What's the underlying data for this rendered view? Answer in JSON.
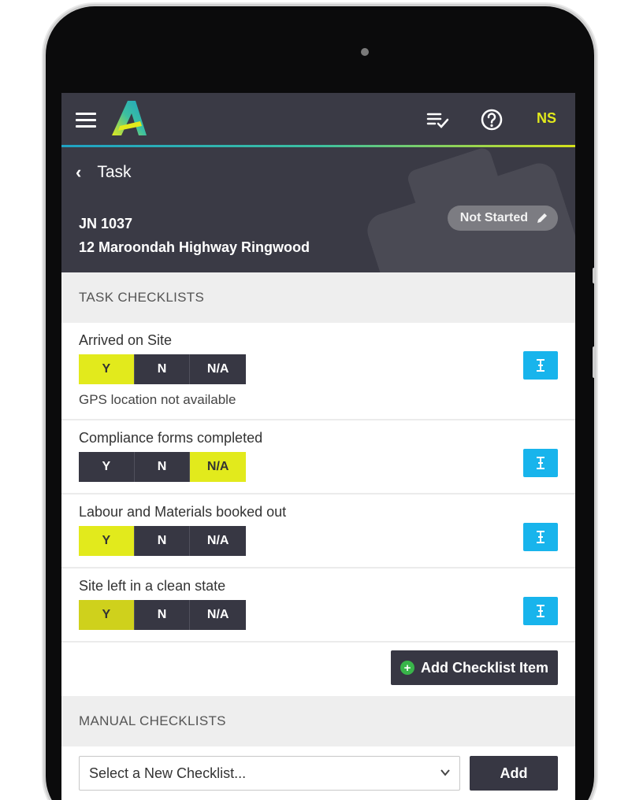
{
  "header": {
    "initials": "NS",
    "back_label": "Task",
    "job_number": "JN 1037",
    "job_address": "12 Maroondah Highway Ringwood",
    "status": "Not Started"
  },
  "task_checklists": {
    "heading": "TASK CHECKLISTS",
    "options": [
      "Y",
      "N",
      "N/A"
    ],
    "items": [
      {
        "label": "Arrived on Site",
        "selected": "Y",
        "note": "GPS location not available"
      },
      {
        "label": "Compliance forms completed",
        "selected": "N/A",
        "note": ""
      },
      {
        "label": "Labour and Materials booked out",
        "selected": "Y",
        "note": ""
      },
      {
        "label": "Site left in a clean state",
        "selected": "Y",
        "note": ""
      }
    ],
    "add_item_label": "Add Checklist Item"
  },
  "manual_checklists": {
    "heading": "MANUAL CHECKLISTS",
    "select_value": "Select a New Checklist...",
    "add_label": "Add"
  },
  "colors": {
    "header_bg": "#3a3a45",
    "accent_yellow": "#e2ea1c",
    "attach_blue": "#18b4ec",
    "dark_button": "#373743"
  },
  "icons": {
    "menu": "hamburger-menu-icon",
    "tasks": "checklist-icon",
    "help": "help-circle-icon",
    "back": "chevron-left-icon",
    "edit": "pencil-icon",
    "attach": "text-cursor-icon",
    "add": "plus-circle-icon",
    "dropdown": "chevron-down-icon"
  }
}
